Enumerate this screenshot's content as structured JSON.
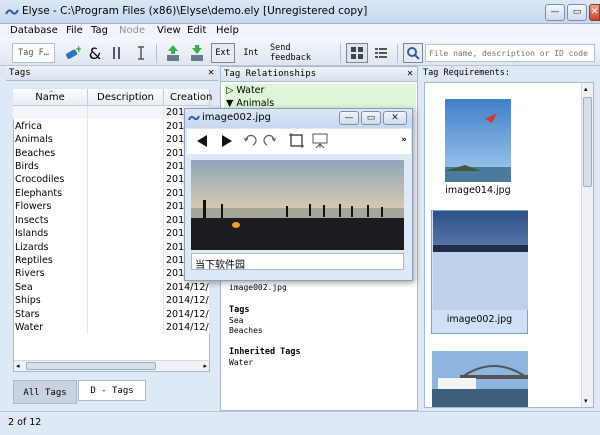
{
  "window": {
    "title": "Elyse - C:\\Program Files (x86)\\Elyse\\demo.ely [Unregistered copy]",
    "min": "—",
    "max": "▭",
    "close": "✕"
  },
  "menu": [
    "Database",
    "File",
    "Tag",
    "Node",
    "View",
    "Edit",
    "Help"
  ],
  "toolbar": {
    "tag_filter": "Tag F…",
    "ext": "Ext",
    "int": "Int",
    "send_feedback": "Send feedback",
    "search_placeholder": "File name, description or ID code"
  },
  "tags_panel": {
    "title": "Tags",
    "columns": [
      "Name",
      "Description",
      "Creation"
    ],
    "rows": [
      [
        "",
        "",
        "201"
      ],
      [
        "Africa",
        "",
        "201"
      ],
      [
        "Animals",
        "",
        "201"
      ],
      [
        "Beaches",
        "",
        "201"
      ],
      [
        "Birds",
        "",
        "201"
      ],
      [
        "Crocodiles",
        "",
        "201"
      ],
      [
        "Elephants",
        "",
        "201"
      ],
      [
        "Flowers",
        "",
        "201"
      ],
      [
        "Insects",
        "",
        "201"
      ],
      [
        "Islands",
        "",
        "201"
      ],
      [
        "Lizards",
        "",
        "201"
      ],
      [
        "Reptiles",
        "",
        "201"
      ],
      [
        "Rivers",
        "",
        "201"
      ],
      [
        "Sea",
        "",
        "2014/12/3"
      ],
      [
        "Ships",
        "",
        "2014/12/3"
      ],
      [
        "Stars",
        "",
        "2014/12/3"
      ],
      [
        "Water",
        "",
        "2014/12/3"
      ]
    ],
    "tabs": [
      "All Tags",
      "D - Tags"
    ]
  },
  "relationships": {
    "title": "Tag Relationships",
    "items": [
      {
        "arrow": "▷",
        "label": "Water"
      },
      {
        "arrow": "▼",
        "label": "Animals"
      }
    ]
  },
  "preview": {
    "title": "image002.jpg",
    "caption": "当下软件园",
    "filename": "image002.jpg",
    "tags_label": "Tags",
    "tags": [
      "Sea",
      "Beaches"
    ],
    "inherited_label": "Inherited Tags",
    "inherited": [
      "Water"
    ]
  },
  "requirements": {
    "title": "Tag Requirements:",
    "thumbs": [
      {
        "label": "image014.jpg"
      },
      {
        "label": "image002.jpg"
      },
      {
        "label": ""
      }
    ]
  },
  "status": {
    "text": "2 of 12"
  },
  "colors": {
    "accent": "#3f7fd0",
    "selected": "#cfe0f6",
    "relationship_bg": "#dff6d8"
  }
}
